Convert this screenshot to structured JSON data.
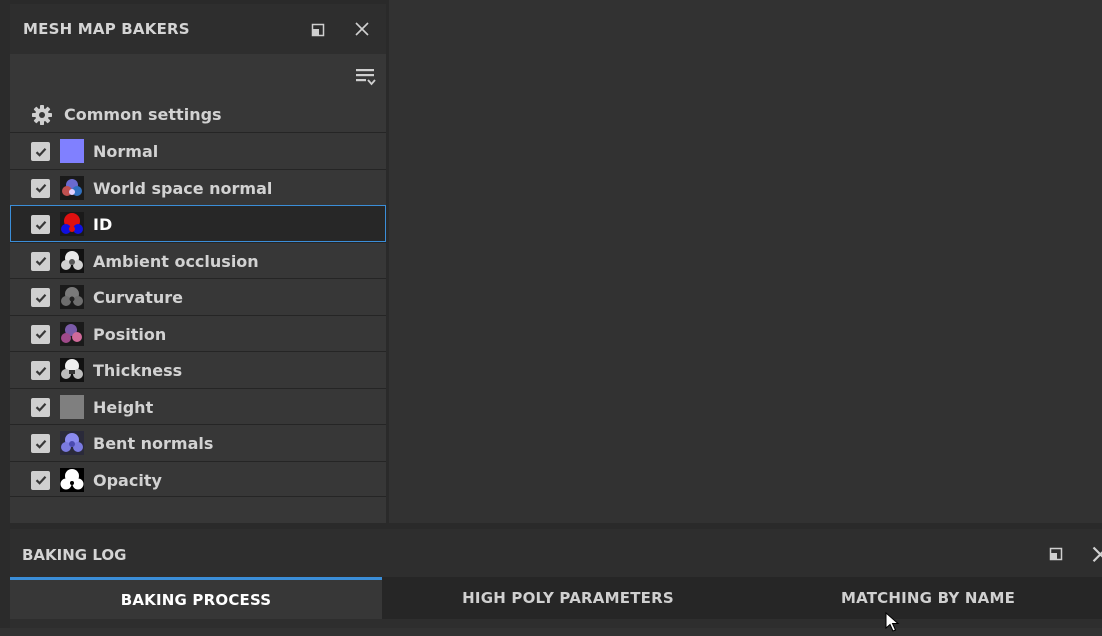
{
  "bakers_panel": {
    "title": "MESH MAP BAKERS",
    "common_settings_label": "Common settings",
    "bakers": [
      {
        "label": "Normal",
        "checked": true,
        "icon": "normal-map-icon"
      },
      {
        "label": "World space normal",
        "checked": true,
        "icon": "world-space-normal-icon"
      },
      {
        "label": "ID",
        "checked": true,
        "icon": "id-map-icon",
        "selected": true
      },
      {
        "label": "Ambient occlusion",
        "checked": true,
        "icon": "ambient-occlusion-icon"
      },
      {
        "label": "Curvature",
        "checked": true,
        "icon": "curvature-icon"
      },
      {
        "label": "Position",
        "checked": true,
        "icon": "position-icon"
      },
      {
        "label": "Thickness",
        "checked": true,
        "icon": "thickness-icon"
      },
      {
        "label": "Height",
        "checked": true,
        "icon": "height-icon"
      },
      {
        "label": "Bent normals",
        "checked": true,
        "icon": "bent-normals-icon"
      },
      {
        "label": "Opacity",
        "checked": true,
        "icon": "opacity-icon"
      }
    ]
  },
  "baking_log": {
    "title": "BAKING LOG",
    "tabs": [
      {
        "label": "BAKING PROCESS",
        "active": true
      },
      {
        "label": "HIGH POLY PARAMETERS",
        "active": false
      },
      {
        "label": "MATCHING BY NAME",
        "active": false
      }
    ]
  },
  "colors": {
    "accent": "#3b8ed8",
    "panel_bg": "#373737",
    "header_bg": "#2e2e2e"
  }
}
